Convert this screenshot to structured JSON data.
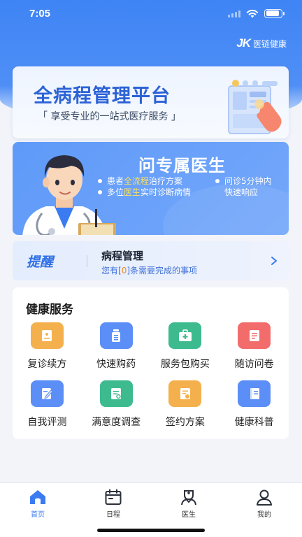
{
  "status_bar": {
    "time": "7:05"
  },
  "brand": {
    "logo_text": "JK",
    "name": "医链健康"
  },
  "banner": {
    "title": "全病程管理平台",
    "subtitle": "「 享受专业的一站式医疗服务 」"
  },
  "doctor_card": {
    "title": "问专属医生",
    "features": [
      {
        "prefix": "患者",
        "highlight": "全流程",
        "suffix": "治疗方案"
      },
      {
        "prefix": "多位",
        "highlight": "医生",
        "suffix": "实时诊断病情"
      },
      {
        "line1": "问诊5分钟内",
        "line2": "快速响应"
      }
    ]
  },
  "reminder": {
    "tag": "提醒",
    "title": "病程管理",
    "text_prefix": "您有[",
    "count": "0",
    "text_suffix": "]条需要完成的事项"
  },
  "services": {
    "title": "健康服务",
    "items": [
      {
        "label": "复诊续方",
        "icon": "prescription-renew-icon",
        "color": "#f5b04e"
      },
      {
        "label": "快速购药",
        "icon": "medicine-bottle-icon",
        "color": "#5b8ef7"
      },
      {
        "label": "服务包购买",
        "icon": "medical-kit-icon",
        "color": "#3dbb8f"
      },
      {
        "label": "随访问卷",
        "icon": "questionnaire-icon",
        "color": "#f26c6c"
      },
      {
        "label": "自我评测",
        "icon": "self-assessment-icon",
        "color": "#5b8ef7"
      },
      {
        "label": "满意度调查",
        "icon": "survey-icon",
        "color": "#3dbb8f"
      },
      {
        "label": "签约方案",
        "icon": "contract-icon",
        "color": "#f5b04e"
      },
      {
        "label": "健康科普",
        "icon": "book-icon",
        "color": "#5b8ef7"
      }
    ]
  },
  "tabbar": {
    "items": [
      {
        "label": "首页",
        "icon": "home-icon",
        "active": true
      },
      {
        "label": "日程",
        "icon": "calendar-icon",
        "active": false
      },
      {
        "label": "医生",
        "icon": "doctor-icon",
        "active": false
      },
      {
        "label": "我的",
        "icon": "profile-icon",
        "active": false
      }
    ]
  },
  "colors": {
    "primary": "#3a7bf2",
    "highlight": "#ffe15b",
    "reminder_count": "#f0892a"
  }
}
